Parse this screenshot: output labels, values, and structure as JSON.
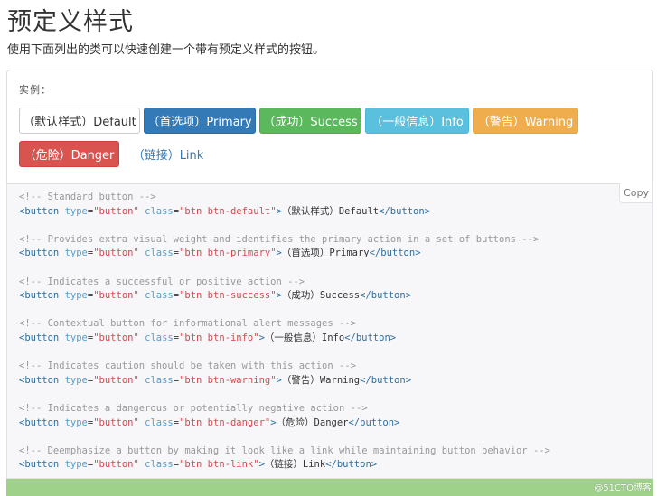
{
  "page": {
    "title": "预定义样式",
    "description": "使用下面列出的类可以快速创建一个带有预定义样式的按钮。"
  },
  "example": {
    "label": "实例：",
    "buttons": [
      {
        "label": "（默认样式）Default",
        "variant": "default"
      },
      {
        "label": "（首选项）Primary",
        "variant": "primary"
      },
      {
        "label": "（成功）Success",
        "variant": "success"
      },
      {
        "label": "（一般信息）Info",
        "variant": "info"
      },
      {
        "label": "（警告）Warning",
        "variant": "warning"
      },
      {
        "label": "（危险）Danger",
        "variant": "danger"
      },
      {
        "label": "（链接）Link",
        "variant": "link"
      }
    ]
  },
  "code": {
    "copy_label": "Copy",
    "blocks": [
      {
        "comment": "<!-- Standard button -->",
        "cls": "btn btn-default",
        "text": "（默认样式）Default"
      },
      {
        "comment": "<!-- Provides extra visual weight and identifies the primary action in a set of buttons -->",
        "cls": "btn btn-primary",
        "text": "（首选项）Primary"
      },
      {
        "comment": "<!-- Indicates a successful or positive action -->",
        "cls": "btn btn-success",
        "text": "（成功）Success"
      },
      {
        "comment": "<!-- Contextual button for informational alert messages -->",
        "cls": "btn btn-info",
        "text": "（一般信息）Info"
      },
      {
        "comment": "<!-- Indicates caution should be taken with this action -->",
        "cls": "btn btn-warning",
        "text": "（警告）Warning"
      },
      {
        "comment": "<!-- Indicates a dangerous or potentially negative action -->",
        "cls": "btn btn-danger",
        "text": "（危险）Danger"
      },
      {
        "comment": "<!-- Deemphasize a button by making it look like a link while maintaining button behavior -->",
        "cls": "btn btn-link",
        "text": "（链接）Link"
      }
    ],
    "tag_open": "<button",
    "attr_type": "type",
    "type_value": "\"button\"",
    "attr_class": "class",
    "tag_close": "</button>"
  },
  "watermark": "@51CTO博客",
  "colors": {
    "primary": "#337ab7",
    "success": "#5cb85c",
    "info": "#5bc0de",
    "warning": "#f0ad4e",
    "danger": "#d9534f",
    "footer_bar": "#9fd18b"
  }
}
